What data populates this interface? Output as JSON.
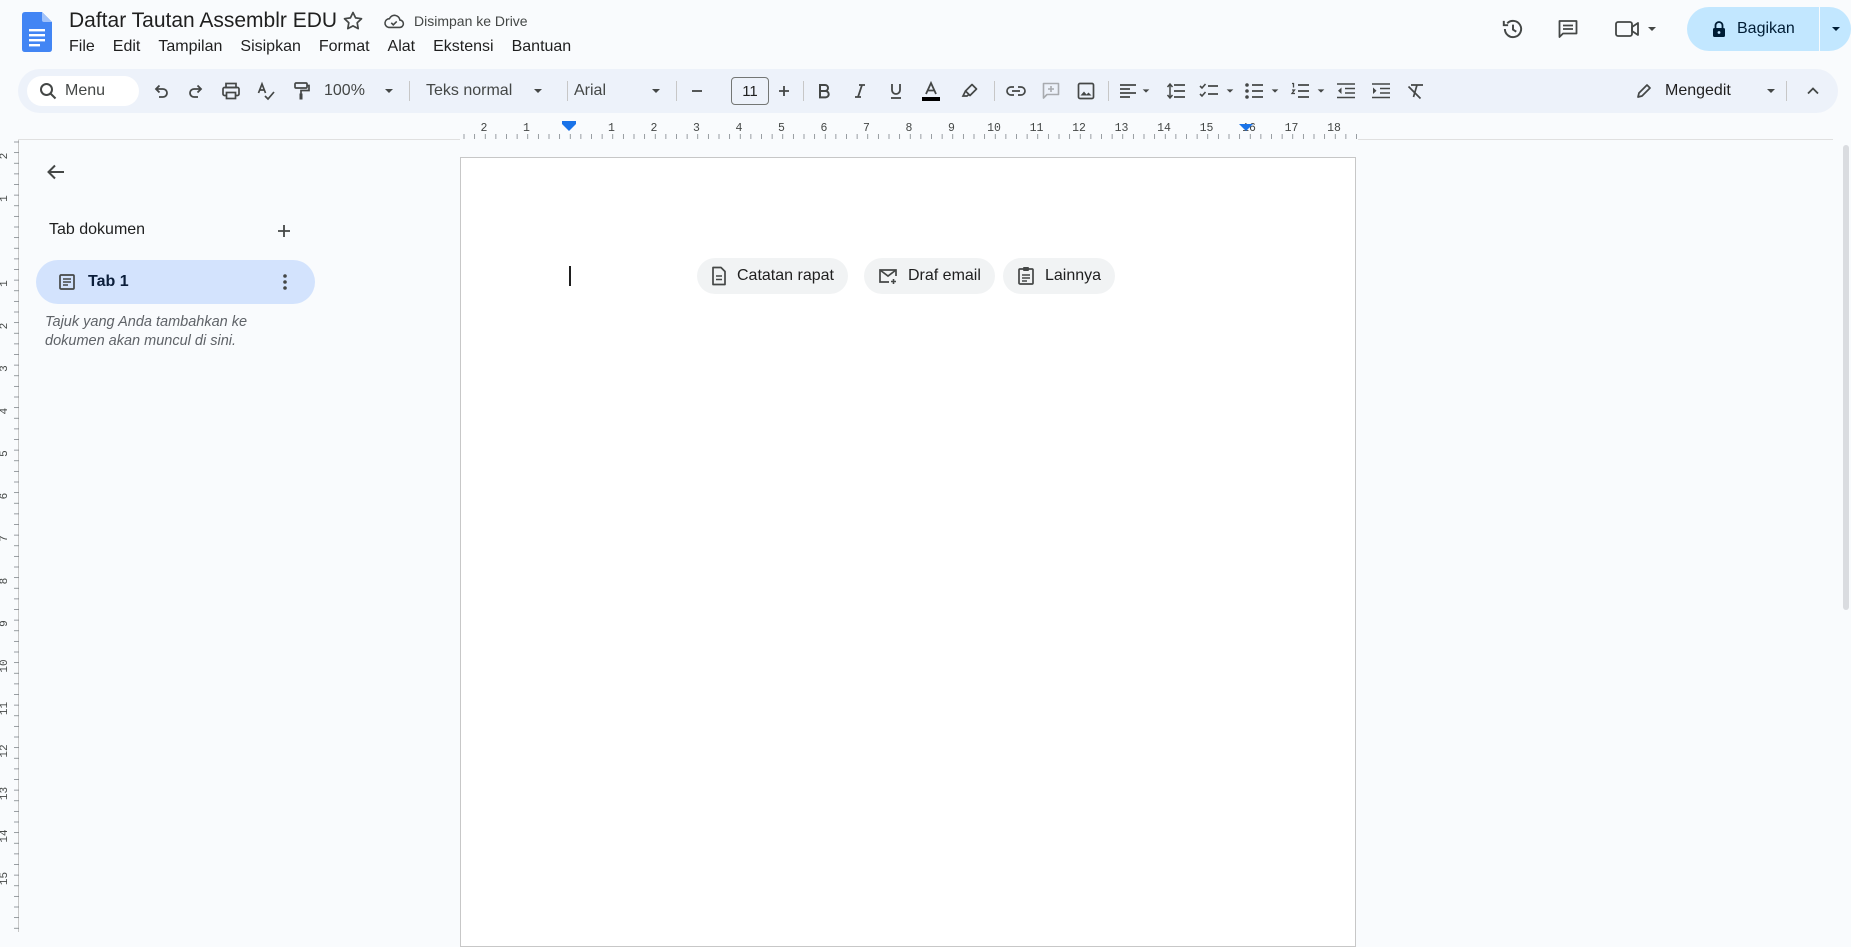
{
  "header": {
    "title": "Daftar Tautan Assemblr EDU",
    "saved_status": "Disimpan ke Drive",
    "share_label": "Bagikan"
  },
  "menu": [
    "File",
    "Edit",
    "Tampilan",
    "Sisipkan",
    "Format",
    "Alat",
    "Ekstensi",
    "Bantuan"
  ],
  "toolbar": {
    "search_label": "Menu",
    "zoom": "100%",
    "style": "Teks normal",
    "font": "Arial",
    "font_size": "11",
    "mode": "Mengedit"
  },
  "sidebar": {
    "heading": "Tab dokumen",
    "tab_label": "Tab 1",
    "note": "Tajuk yang Anda tambahkan ke dokumen akan muncul di sini."
  },
  "chips": [
    "Catatan rapat",
    "Draf email",
    "Lainnya"
  ],
  "ruler": {
    "h_ticks": [
      "2",
      "1",
      "1",
      "2",
      "3",
      "4",
      "5",
      "6",
      "7",
      "8",
      "9",
      "10",
      "11",
      "12",
      "13",
      "14",
      "15",
      "16",
      "17",
      "18"
    ],
    "v_ticks": [
      "2",
      "1",
      "1",
      "2",
      "3",
      "4",
      "5",
      "6",
      "7",
      "8",
      "9",
      "10",
      "11",
      "12",
      "13",
      "14",
      "15"
    ]
  },
  "colors": {
    "accent": "#1a73e8",
    "share_bg": "#c2e7ff",
    "toolbar_bg": "#edf2fa",
    "tab_active_bg": "#d3e3fd"
  }
}
